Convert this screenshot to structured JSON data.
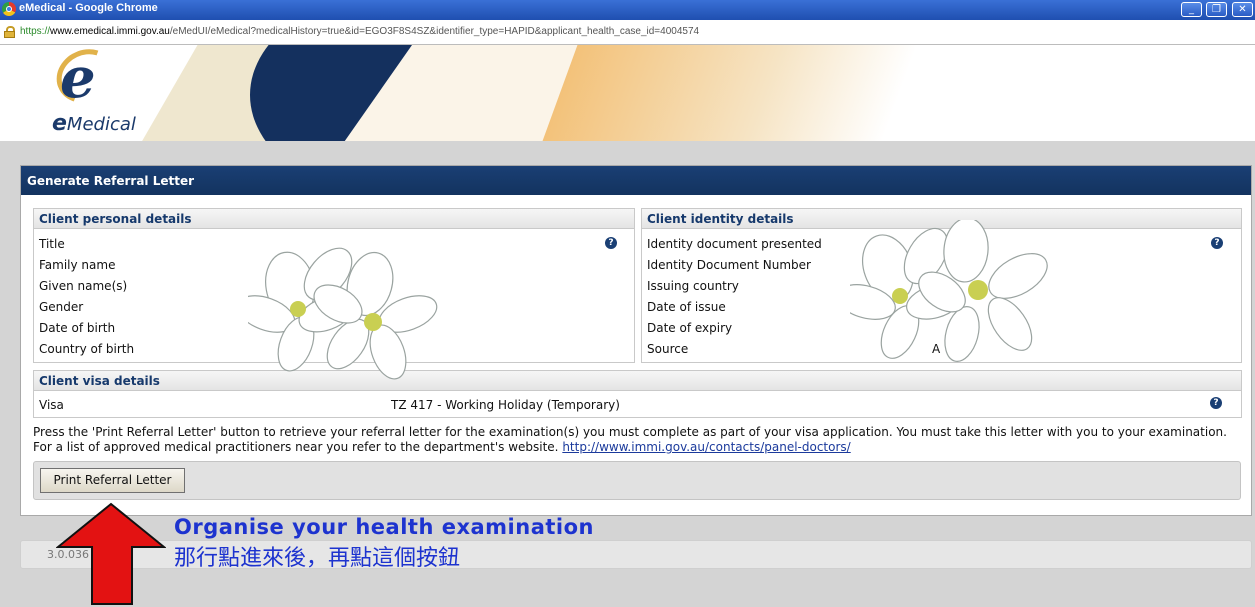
{
  "window": {
    "title": "eMedical - Google Chrome",
    "minimize": "_",
    "restore": "❐",
    "close": "✕"
  },
  "address": {
    "scheme": "https://",
    "host": "www.emedical.immi.gov.au",
    "path": "/eMedUI/eMedical?medicalHistory=true&id=EGO3F8S4SZ&identifier_type=HAPID&applicant_health_case_id=4004574"
  },
  "logo": {
    "letter": "e",
    "text_initial": "e",
    "text_rest": "Medical"
  },
  "panel": {
    "title": "Generate Referral Letter"
  },
  "personal": {
    "title": "Client personal details",
    "labels": [
      "Title",
      "Family name",
      "Given name(s)",
      "Gender",
      "Date of birth",
      "Country of birth"
    ],
    "help": "?"
  },
  "identity": {
    "title": "Client identity details",
    "labels": [
      "Identity document presented",
      "Identity Document Number",
      "Issuing country",
      "Date of issue",
      "Date of expiry",
      "Source"
    ],
    "source_value_fragment": "A",
    "help": "?"
  },
  "visa": {
    "title": "Client visa details",
    "label": "Visa",
    "value": "TZ 417 - Working Holiday (Temporary)",
    "help": "?"
  },
  "instructions": {
    "text": "Press the 'Print Referral Letter' button to retrieve your referral letter for the examination(s) you must complete as part of your visa application. You must take this letter with you to your examination. For a list of approved medical practitioners near you refer to the department's website.",
    "link": "http://www.immi.gov.au/contacts/panel-doctors/"
  },
  "actions": {
    "print_label": "Print Referral Letter"
  },
  "footer": {
    "version": "3.0.036"
  },
  "annotation": {
    "line1": "Organise your health examination",
    "line2": "那行點進來後，再點這個按鈕",
    "color": "#1d33cf",
    "arrow_color": "#e31212"
  }
}
